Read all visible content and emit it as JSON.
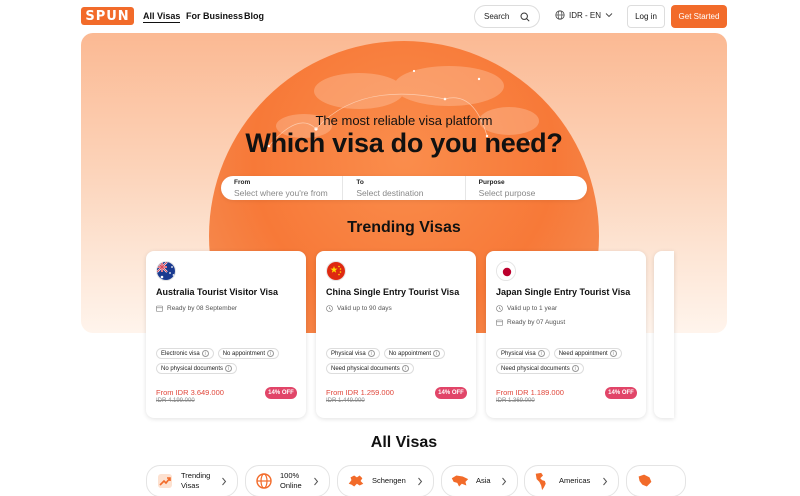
{
  "header": {
    "logo": "SPUN",
    "nav": [
      "All Visas",
      "For Business",
      "Blog"
    ],
    "search_label": "Search",
    "language": "IDR - EN",
    "login": "Log in",
    "cta": "Get Started"
  },
  "hero": {
    "subtitle": "The most reliable visa platform",
    "title": "Which visa do you need?",
    "search": {
      "from_label": "From",
      "from_placeholder": "Select where you're from",
      "to_label": "To",
      "to_placeholder": "Select destination",
      "purpose_label": "Purpose",
      "purpose_placeholder": "Select purpose"
    }
  },
  "trending": {
    "title": "Trending Visas",
    "cards": [
      {
        "flag": "australia",
        "title": "Australia Tourist Visitor Visa",
        "meta": [
          "Ready by 08 September"
        ],
        "tags": [
          "Electronic visa",
          "No appointment",
          "No physical documents"
        ],
        "price": "From IDR 3.649.000",
        "old_price": "IDR 4.199.000",
        "discount": "14% OFF"
      },
      {
        "flag": "china",
        "title": "China Single Entry Tourist Visa",
        "meta": [
          "Valid up to 90 days"
        ],
        "tags": [
          "Physical visa",
          "No appointment",
          "Need physical documents"
        ],
        "price": "From IDR 1.259.000",
        "old_price": "IDR 1.449.000",
        "discount": "14% OFF"
      },
      {
        "flag": "japan",
        "title": "Japan Single Entry Tourist Visa",
        "meta": [
          "Valid up to 1 year",
          "Ready by 07 August"
        ],
        "tags": [
          "Physical visa",
          "Need appointment",
          "Need physical documents"
        ],
        "price": "From IDR 1.189.000",
        "old_price": "IDR 1.369.000",
        "discount": "14% OFF"
      }
    ]
  },
  "all_visas": {
    "title": "All Visas",
    "categories": [
      {
        "label": "Trending Visas",
        "icon": "trending-icon"
      },
      {
        "label": "100% Online",
        "icon": "globe-icon"
      },
      {
        "label": "Schengen",
        "icon": "europe-map-icon"
      },
      {
        "label": "Asia",
        "icon": "asia-map-icon"
      },
      {
        "label": "Americas",
        "icon": "americas-map-icon"
      }
    ]
  },
  "colors": {
    "brand": "#f26b2a",
    "discount": "#e14568",
    "price": "#e1473b"
  }
}
